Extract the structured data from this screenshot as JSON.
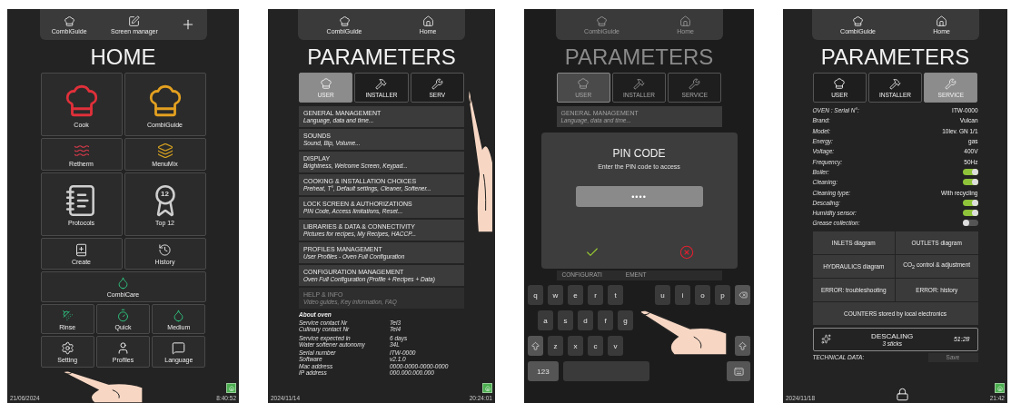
{
  "home_screen": {
    "top_bar": [
      "CombiGuide",
      "Screen manager"
    ],
    "title": "HOME",
    "tile_rows": [
      [
        {
          "label": "Cook"
        },
        {
          "label": "CombiGuide"
        }
      ],
      [
        {
          "label": "Retherm"
        },
        {
          "label": "MenuMix"
        }
      ],
      [
        {
          "label": "Protocols"
        },
        {
          "label": "Top 12",
          "badge": "12"
        }
      ],
      [
        {
          "label": "Create"
        },
        {
          "label": "History"
        }
      ],
      [
        {
          "label": "CombiCare"
        }
      ],
      [
        {
          "label": "Rinse"
        },
        {
          "label": "Quick"
        },
        {
          "label": "Medium"
        }
      ],
      [
        {
          "label": "Setting"
        },
        {
          "label": "Profiles"
        },
        {
          "label": "Language"
        }
      ]
    ],
    "date": "21/06/2024",
    "time": "8:40:52"
  },
  "user_parameters_screen": {
    "top_bar": [
      "CombiGuide",
      "Home"
    ],
    "title": "PARAMETERS",
    "tabs": [
      {
        "label": "USER",
        "selected": true
      },
      {
        "label": "INSTALLER",
        "selected": false
      },
      {
        "label": "SERV",
        "selected": false
      }
    ],
    "menu": [
      {
        "title": "GENERAL MANAGEMENT",
        "subtitle": "Language, data and time...",
        "disabled": false
      },
      {
        "title": "SOUNDS",
        "subtitle": "Sound, Bip, Volume...",
        "disabled": false
      },
      {
        "title": "DISPLAY",
        "subtitle": "Brightness, Welcome Screen, Keypad...",
        "disabled": false
      },
      {
        "title": "COOKING & INSTALLATION CHOICES",
        "subtitle": "Preheat, T°, Default settings, Cleaner, Softener...",
        "disabled": false
      },
      {
        "title": "LOCK SCREEN & AUTHORIZATIONS",
        "subtitle": "PIN Code, Access limitations, Reset...",
        "disabled": false
      },
      {
        "title": "LIBRARIES & DATA & CONNECTIVITY",
        "subtitle": "Pictures for recipes, My Recipes, HACCP...",
        "disabled": false
      },
      {
        "title": "PROFILES MANAGEMENT",
        "subtitle": "User Profiles - Oven Full Configuration",
        "disabled": false
      },
      {
        "title": "CONFIGURATION MANAGEMENT",
        "subtitle": "Oven Full Configuration (Profile + Recipes + Data)",
        "disabled": false
      },
      {
        "title": "HELP & INFO",
        "subtitle": "Video guides, Key information, FAQ",
        "disabled": true
      }
    ],
    "about": {
      "heading": "About oven",
      "groups": [
        [
          {
            "label": "Service contact Nr",
            "value": "Tel3"
          },
          {
            "label": "Culinary contact Nr",
            "value": "Tel4"
          }
        ],
        [
          {
            "label": "Service expected in",
            "value": "6 days"
          },
          {
            "label": "Water softener autonomy",
            "value": "34L"
          }
        ],
        [
          {
            "label": "Serial number",
            "value": "ITW-0000"
          },
          {
            "label": "Software",
            "value": "v2.1.0"
          },
          {
            "label": "Mac address",
            "value": "0000-0000-0000-0000"
          },
          {
            "label": "IP address",
            "value": "000.000.000.000"
          }
        ]
      ]
    },
    "date": "2024/11/14",
    "time": "20:24:01"
  },
  "pin_code_screen": {
    "top_bar": [
      "CombiGuide",
      "Home"
    ],
    "title": "PARAMETERS",
    "tabs": [
      {
        "label": "USER",
        "selected": true
      },
      {
        "label": "INSTALLER",
        "selected": false
      },
      {
        "label": "SERVICE",
        "selected": false
      }
    ],
    "menu": [
      {
        "title": "GENERAL MANAGEMENT",
        "subtitle": "Language, data and time..."
      }
    ],
    "dialog": {
      "title": "PIN CODE",
      "message": "Enter the PIN code to access",
      "value": "••••"
    },
    "behind_dialog": [
      "CONFIGURATI",
      "EMENT"
    ],
    "keyboard": {
      "row_1": [
        [
          "q",
          "w",
          "e",
          "r",
          "t"
        ],
        [
          "u",
          "i",
          "o",
          "p"
        ]
      ],
      "row_2": [
        "a",
        "s",
        "d",
        "f",
        "g"
      ],
      "row_3": [
        "z",
        "x",
        "c",
        "v"
      ],
      "row_4": [
        "123"
      ]
    }
  },
  "service_parameters_screen": {
    "top_bar": [
      "CombiGuide",
      "Home"
    ],
    "title": "PARAMETERS",
    "tabs": [
      {
        "label": "USER",
        "selected": false
      },
      {
        "label": "INSTALLER",
        "selected": false
      },
      {
        "label": "SERVICE",
        "selected": true
      }
    ],
    "specs": [
      {
        "label": "OVEN : Serial N°:",
        "kind": "text",
        "value": "ITW-0000"
      },
      {
        "label": "Brand:",
        "kind": "text",
        "value": "Vulcan"
      },
      {
        "label": "Model:",
        "kind": "text",
        "value": "10lev. GN 1/1"
      },
      {
        "label": "Energy:",
        "kind": "text",
        "value": "gas"
      },
      {
        "label": "Voltage:",
        "kind": "text",
        "value": "400V"
      },
      {
        "label": "Frequency:",
        "kind": "text",
        "value": "50Hz"
      },
      {
        "label": "Boiler:",
        "kind": "toggle",
        "on": true
      },
      {
        "label": "Cleaning:",
        "kind": "toggle",
        "on": true
      },
      {
        "label": "Cleaning type:",
        "kind": "text",
        "value": "With recycling"
      },
      {
        "label": "Descaling:",
        "kind": "toggle",
        "on": true
      },
      {
        "label": "Humidity sensor:",
        "kind": "toggle",
        "on": true
      },
      {
        "label": "Grease collection:",
        "kind": "toggle",
        "on": false
      }
    ],
    "actions": [
      [
        "INLETS diagram",
        "OUTLETS diagram"
      ],
      [
        "HYDRAULICS diagram",
        "CO$_{2}$ control & adjustment"
      ],
      [
        "ERROR: troubleshooting",
        "ERROR: history"
      ],
      [
        "COUNTERS stored by local electronics"
      ]
    ],
    "descaling": {
      "title": "DESCALING",
      "detail": "3 sticks",
      "timer": "51:28"
    },
    "technical_data": {
      "label": "TECHNICAL DATA:",
      "save": "Save",
      "save_disabled": true
    },
    "date": "2024/11/18",
    "time": "21:42"
  }
}
